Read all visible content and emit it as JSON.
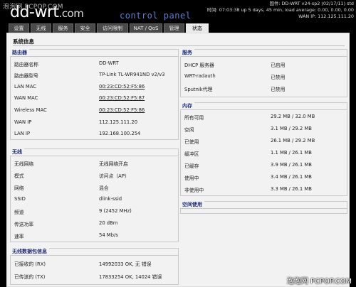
{
  "watermark": {
    "top": "泡泡网 PCPOP.COM",
    "bottom": "泡泡网 PCPOP.COM"
  },
  "header": {
    "logo_main": "dd-wrt",
    "logo_suffix": ".com",
    "subtitle": "control panel",
    "firmware": "固件: DD-WRT v24-sp2 (02/17/11) std",
    "time": "时间: 07:03:38 up 5 days, 45 min, load average: 0.00, 0.00, 0.00",
    "wan_ip": "WAN IP: 112.125.111.20"
  },
  "nav": {
    "tabs": [
      {
        "label": "设置"
      },
      {
        "label": "无线"
      },
      {
        "label": "服务"
      },
      {
        "label": "安全"
      },
      {
        "label": "访问限制"
      },
      {
        "label": "NAT / QoS"
      },
      {
        "label": "管理"
      },
      {
        "label": "状态"
      }
    ]
  },
  "page_title": "系统信息",
  "router": {
    "title": "路由器",
    "rows": [
      {
        "label": "路由器名称",
        "value": "DD-WRT"
      },
      {
        "label": "路由器型号",
        "value": "TP-Link TL-WR941ND v2/v3"
      },
      {
        "label": "LAN MAC",
        "value": "00:23:CD:52:F5:86"
      },
      {
        "label": "WAN MAC",
        "value": "00:23:CD:52:F5:87"
      },
      {
        "label": "Wireless MAC",
        "value": "00:23:CD:52:F5:86"
      },
      {
        "label": "WAN IP",
        "value": "112.125.111.20"
      },
      {
        "label": "LAN IP",
        "value": "192.168.100.254"
      }
    ]
  },
  "wireless": {
    "title": "无线",
    "rows": [
      {
        "label": "无线网络",
        "value": "无线网络开启"
      },
      {
        "label": "模式",
        "value": "访问点（AP）"
      },
      {
        "label": "网络",
        "value": "混合"
      },
      {
        "label": "SSID",
        "value": "dlink-ssid"
      },
      {
        "label": "频道",
        "value": "9 (2452 MHz)"
      },
      {
        "label": "传送功率",
        "value": "20 dBm"
      },
      {
        "label": "速率",
        "value": "54 Mb/s"
      }
    ]
  },
  "packets": {
    "title": "无线数据包信息",
    "rows": [
      {
        "label": "已接收的 (RX)",
        "value": "14992033 OK, 无 错误"
      },
      {
        "label": "已传送的 (TX)",
        "value": "17833254 OK, 14024 错误"
      }
    ]
  },
  "services": {
    "title": "服务",
    "rows": [
      {
        "label": "DHCP 服务器",
        "value": "已启用"
      },
      {
        "label": "WRT-radauth",
        "value": "已禁用"
      },
      {
        "label": "Sputnik代理",
        "value": "已禁用"
      }
    ]
  },
  "memory": {
    "title": "内存",
    "rows": [
      {
        "label": "所有可用",
        "value": "29.2 MB / 32.0 MB"
      },
      {
        "label": "空闲",
        "value": "3.1 MB / 29.2 MB"
      },
      {
        "label": "已使用",
        "value": "26.1 MB / 29.2 MB"
      },
      {
        "label": "缓冲区",
        "value": "1.1 MB / 26.1 MB"
      },
      {
        "label": "已缓存",
        "value": "3.9 MB / 26.1 MB"
      },
      {
        "label": "使用中",
        "value": "3.4 MB / 26.1 MB"
      },
      {
        "label": "非使用中",
        "value": "3.3 MB / 26.1 MB"
      }
    ]
  },
  "space": {
    "title": "空间使用"
  }
}
